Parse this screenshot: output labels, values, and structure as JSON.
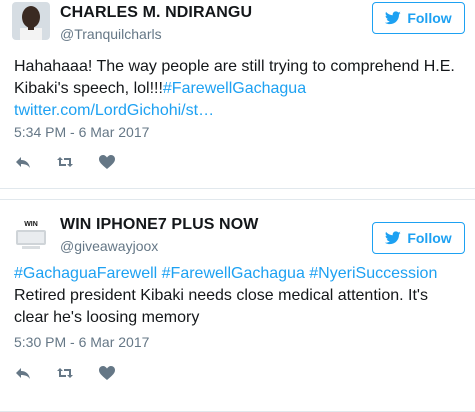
{
  "colors": {
    "accent": "#1da1f2",
    "text": "#14171a",
    "muted": "#657786",
    "icon": "#657786"
  },
  "tweets": [
    {
      "name": "CHARLES M. NDIRANGU",
      "handle": "@Tranquilcharls",
      "follow_label": "Follow",
      "text_plain": "Hahahaaa! The way people are still trying to comprehend H.E. Kibaki's speech, lol!!!",
      "hashtag": "#FarewellGachagua",
      "link": "twitter.com/LordGichohi/st…",
      "time": "5:34 PM - 6 Mar 2017",
      "icons": [
        "reply-icon",
        "retweet-icon",
        "like-icon"
      ]
    },
    {
      "name": "WIN IPHONE7 PLUS NOW",
      "handle": "@giveawayjoox",
      "follow_label": "Follow",
      "hashtags": "#GachaguaFarewell #FarewellGachagua #NyeriSuccession",
      "text_plain": "Retired president Kibaki needs close medical attention. It's clear he's loosing memory",
      "avatar_text": "WIN",
      "time": "5:30 PM - 6 Mar 2017",
      "icons": [
        "reply-icon",
        "retweet-icon",
        "like-icon"
      ]
    }
  ]
}
